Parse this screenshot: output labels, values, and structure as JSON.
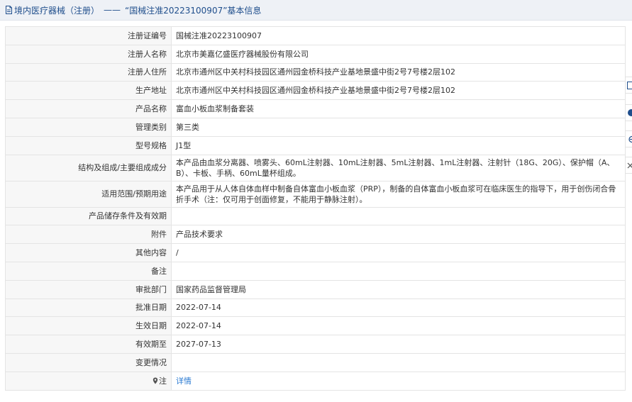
{
  "header": {
    "title": "境内医疗器械（注册）",
    "separator": "——",
    "subtitle": "“国械注准20223100907”基本信息"
  },
  "rows": [
    {
      "label": "注册证编号",
      "value": "国械注准20223100907"
    },
    {
      "label": "注册人名称",
      "value": "北京市美嘉亿盛医疗器械股份有限公司"
    },
    {
      "label": "注册人住所",
      "value": "北京市通州区中关村科技园区通州园金桥科技产业基地景盛中街2号7号楼2层102"
    },
    {
      "label": "生产地址",
      "value": "北京市通州区中关村科技园区通州园金桥科技产业基地景盛中街2号7号楼2层102"
    },
    {
      "label": "产品名称",
      "value": "富血小板血浆制备套装"
    },
    {
      "label": "管理类别",
      "value": "第三类"
    },
    {
      "label": "型号规格",
      "value": "J1型"
    },
    {
      "label": "结构及组成/主要组成成分",
      "value": "本产品由血浆分离器、喷雾头、60mL注射器、10mL注射器、5mL注射器、1mL注射器、注射针（18G、20G）、保护帽（A、B）、卡板、手柄、60mL量杯组成。"
    },
    {
      "label": "适用范围/预期用途",
      "value": "本产品用于从人体自体血样中制备自体富血小板血浆（PRP），制备的自体富血小板血浆可在临床医生的指导下，用于创伤闭合骨折手术（注：仅可用于创面修复，不能用于静脉注射）。"
    },
    {
      "label": "产品储存条件及有效期",
      "value": ""
    },
    {
      "label": "附件",
      "value": "产品技术要求"
    },
    {
      "label": "其他内容",
      "value": "/"
    },
    {
      "label": "备注",
      "value": ""
    },
    {
      "label": "审批部门",
      "value": "国家药品监督管理局"
    },
    {
      "label": "批准日期",
      "value": "2022-07-14"
    },
    {
      "label": "生效日期",
      "value": "2022-07-14"
    },
    {
      "label": "有效期至",
      "value": "2027-07-13"
    },
    {
      "label": "变更情况",
      "value": ""
    }
  ],
  "note_row": {
    "label": "注",
    "link": "详情"
  },
  "colors": {
    "header_bg": "#eef1f6",
    "header_text": "#1f4e8c",
    "link": "#2a7ad2",
    "label_bg": "#f7f7f7",
    "border": "#e4e4e4"
  }
}
